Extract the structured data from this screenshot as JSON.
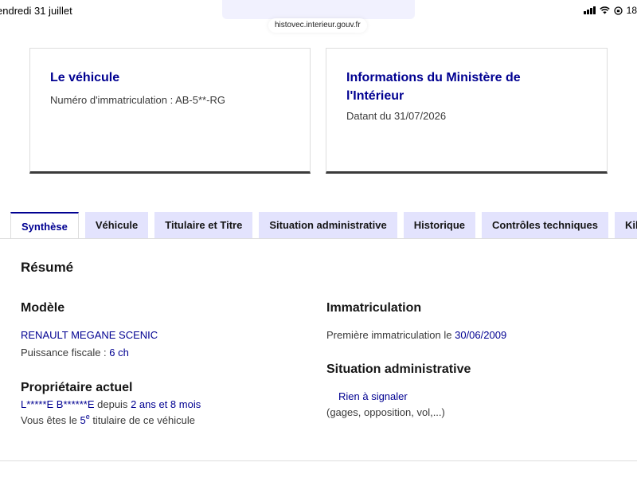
{
  "status_bar": {
    "date": "endredi 31 juillet",
    "right_fragment": "18"
  },
  "browser": {
    "url": "histovec.interieur.gouv.fr"
  },
  "cards": {
    "vehicle": {
      "title": "Le véhicule",
      "plate_line": "Numéro d'immatriculation : AB-5**-RG"
    },
    "ministry": {
      "title_line1": "Informations du Ministère de",
      "title_line2": "l'Intérieur",
      "date_line": "Datant du 31/07/2026"
    }
  },
  "tabs": [
    {
      "label": "Synthèse",
      "active": true
    },
    {
      "label": "Véhicule",
      "active": false
    },
    {
      "label": "Titulaire et Titre",
      "active": false
    },
    {
      "label": "Situation administrative",
      "active": false
    },
    {
      "label": "Historique",
      "active": false
    },
    {
      "label": "Contrôles techniques",
      "active": false
    },
    {
      "label": "Kilo",
      "active": false
    }
  ],
  "summary": {
    "heading": "Résumé",
    "modele": {
      "heading": "Modèle",
      "name": "RENAULT MEGANE SCENIC",
      "puissance_label": "Puissance fiscale : ",
      "puissance_value": "6 ch"
    },
    "proprietaire": {
      "heading": "Propriétaire actuel",
      "name": "L*****E B******E",
      "depuis_label": " depuis ",
      "depuis_value": "2 ans et 8 mois",
      "rank_prefix": "Vous êtes le ",
      "rank_number": "5",
      "rank_sup": "e",
      "rank_suffix": " titulaire de ce véhicule"
    },
    "immatriculation": {
      "heading": "Immatriculation",
      "label": "Première immatriculation le ",
      "date": "30/06/2009"
    },
    "situation": {
      "heading": "Situation administrative",
      "status": "Rien à signaler",
      "details": "(gages, opposition, vol,...)"
    }
  },
  "colors": {
    "accent": "#000091",
    "tab_bg": "#e3e3fd",
    "text": "#161616"
  }
}
